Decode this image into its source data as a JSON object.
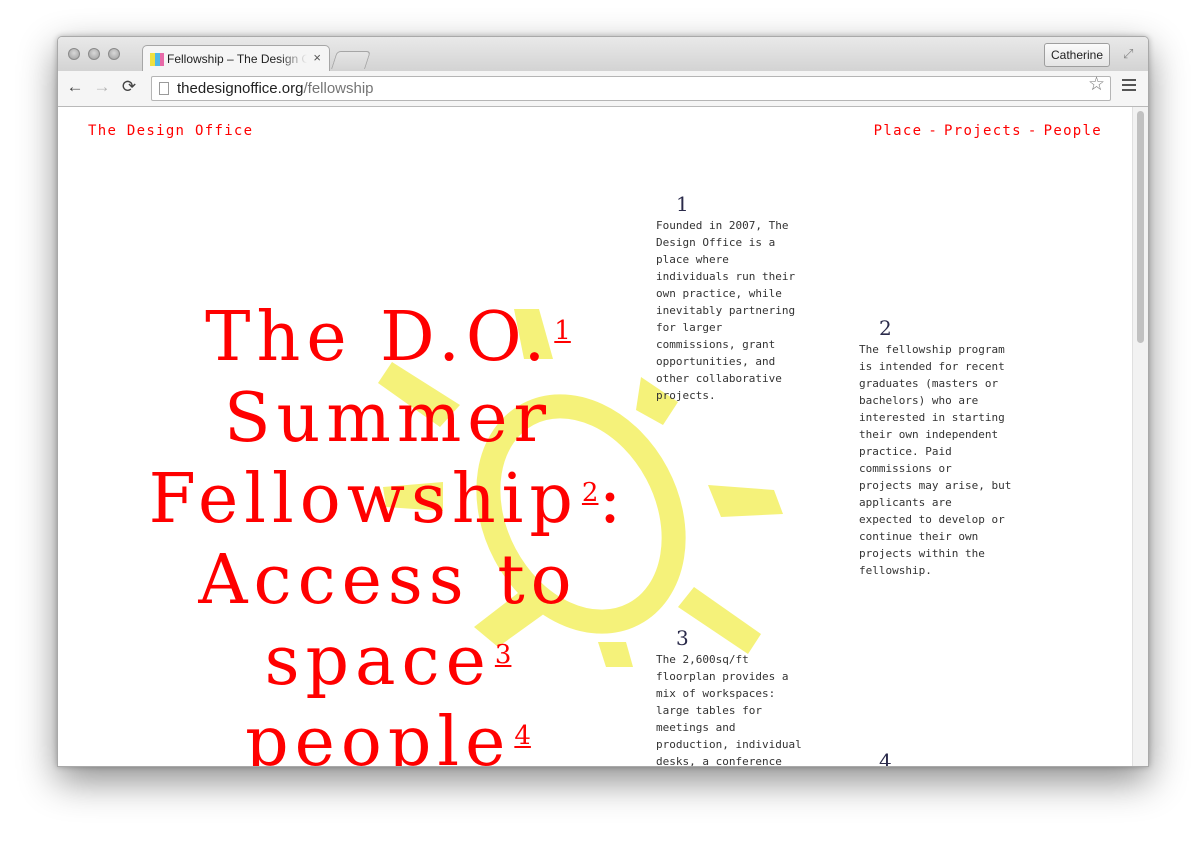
{
  "browser": {
    "tab": {
      "title": "Fellowship – The Design Office",
      "close": "×"
    },
    "profile_name": "Catherine",
    "url": {
      "host": "thedesignoffice.org",
      "path": "/fellowship"
    },
    "back": "←",
    "forward": "→",
    "reload": "⟳",
    "star": "☆",
    "fullscreen": "⤢"
  },
  "site": {
    "logo": "The Design Office",
    "nav": [
      "Place",
      "Projects",
      "People"
    ],
    "nav_separator": "-"
  },
  "headline": {
    "lines": [
      {
        "text": "The D.O.",
        "sup": "1"
      },
      {
        "text": "Summer",
        "sup": ""
      },
      {
        "text": "Fellowship",
        "sup": "2",
        "after": ":"
      },
      {
        "text": "Access to",
        "sup": ""
      },
      {
        "text": "space",
        "sup": "3"
      },
      {
        "text": "people",
        "sup": "4"
      }
    ]
  },
  "notes": [
    {
      "number": "1",
      "text": [
        "Founded in 2007, The",
        "Design Office is a",
        "place where",
        "individuals run their",
        "own practice, while",
        "inevitably partnering",
        "for larger",
        "commissions, grant",
        "opportunities, and",
        "other collaborative",
        "projects."
      ]
    },
    {
      "number": "2",
      "text": [
        "The fellowship program",
        "is intended for recent",
        "graduates (masters or",
        "bachelors) who are",
        "interested in starting",
        "their own independent",
        "practice. Paid",
        "commissions or",
        "projects may arise, but",
        "applicants are",
        "expected to develop or",
        "continue their own",
        "projects within the",
        "fellowship."
      ]
    },
    {
      "number": "3",
      "text": [
        "The 2,600sq/ft",
        "floorplan provides a",
        "mix of workspaces:",
        "large tables for",
        "meetings and",
        "production, individual",
        "desks, a conference"
      ]
    },
    {
      "number": "4",
      "text": []
    }
  ],
  "colors": {
    "accent": "#ff0000",
    "sun": "#f5f27a",
    "note_text": "#333333"
  },
  "icons": {
    "page": "page-icon",
    "star": "star-icon",
    "menu": "menu-icon",
    "sun": "sun-illustration"
  }
}
